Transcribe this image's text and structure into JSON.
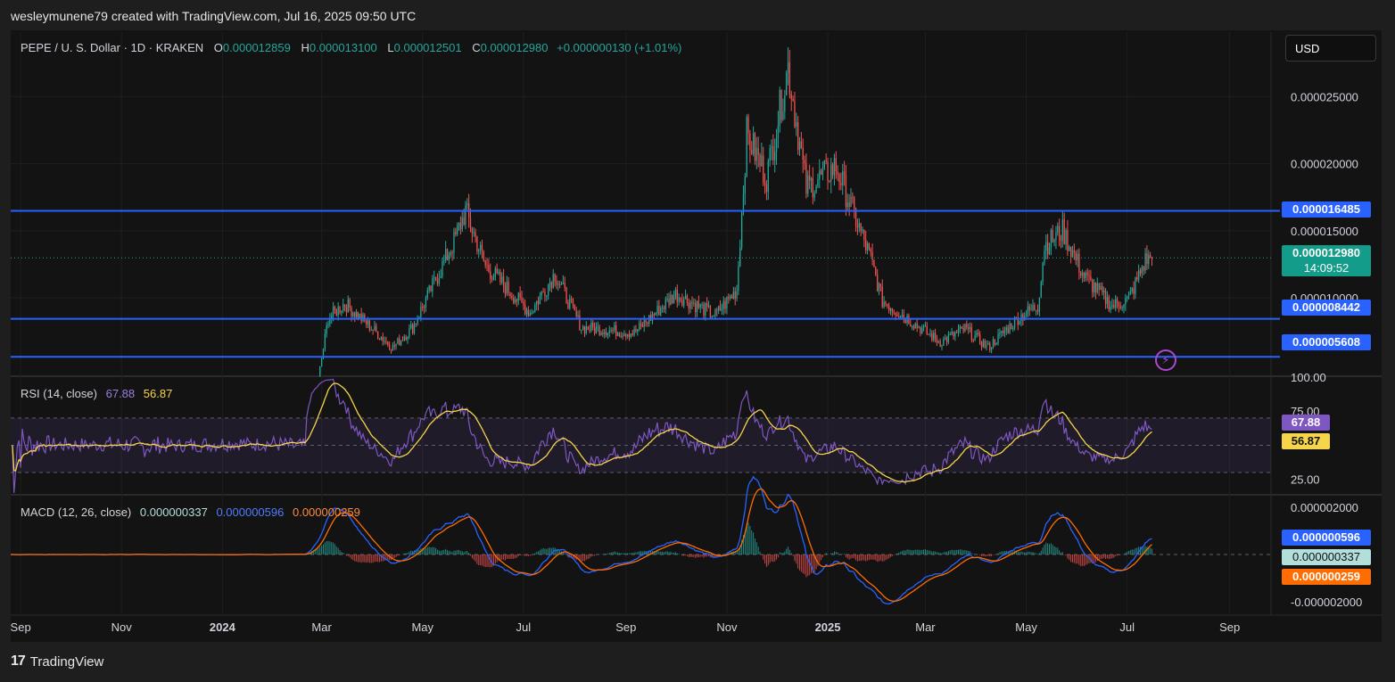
{
  "credit": "wesleymunene79 created with TradingView.com, Jul 16, 2025 09:50 UTC",
  "footer": {
    "brand": "TradingView",
    "logo": "17"
  },
  "currency_button": "USD",
  "price_legend": {
    "symbol": "PEPE / U. S. Dollar · 1D · KRAKEN",
    "o_label": "O",
    "o": "0.000012859",
    "h_label": "H",
    "h": "0.000013100",
    "l_label": "L",
    "l": "0.000012501",
    "c_label": "C",
    "c": "0.000012980",
    "change": "+0.000000130 (+1.01%)"
  },
  "rsi_legend": {
    "label": "RSI (14, close)",
    "rsi": "67.88",
    "ma": "56.87"
  },
  "macd_legend": {
    "label": "MACD (12, 26, close)",
    "hist": "0.000000337",
    "macd": "0.000000596",
    "signal": "0.000000259"
  },
  "badges": {
    "level_top": "0.000016485",
    "current_price": "0.000012980",
    "countdown": "14:09:52",
    "level_mid": "0.000008442",
    "level_low": "0.000005608",
    "rsi": "67.88",
    "rsi_ma": "56.87",
    "macd": "0.000000596",
    "hist": "0.000000337",
    "signal": "0.000000259"
  },
  "colors": {
    "up": "#26a69a",
    "down": "#ef5350",
    "level_line": "#2962ff",
    "rsi_line": "#7e57c2",
    "rsi_ma": "#f7d54a",
    "macd_line": "#2962ff",
    "signal_line": "#ff6d00"
  },
  "chart_data": [
    {
      "type": "candlestick",
      "title": "PEPE / U. S. Dollar · 1D · KRAKEN",
      "x_ticks": [
        "Sep",
        "Nov",
        "2024",
        "Mar",
        "May",
        "Jul",
        "Sep",
        "Nov",
        "2025",
        "Mar",
        "May",
        "Jul",
        "Sep"
      ],
      "y_ticks": [
        "0.000025000",
        "0.000020000",
        "0.000015000",
        "0.000010000"
      ],
      "ylim": [
        4.3e-06,
        2.98e-05
      ],
      "horizontal_levels": [
        1.6485e-05,
        8.442e-06,
        5.608e-06
      ],
      "last_price": 1.298e-05,
      "series_anchors": [
        [
          "2023-08-26",
          1.2e-06
        ],
        [
          "2024-02-20",
          1.2e-06
        ],
        [
          "2024-02-28",
          4e-06
        ],
        [
          "2024-03-05",
          8.5e-06
        ],
        [
          "2024-03-15",
          9.6e-06
        ],
        [
          "2024-04-13",
          6.3e-06
        ],
        [
          "2024-04-25",
          7.8e-06
        ],
        [
          "2024-05-20",
          1.42e-05
        ],
        [
          "2024-05-27",
          1.65e-05
        ],
        [
          "2024-06-08",
          1.24e-05
        ],
        [
          "2024-07-05",
          8.9e-06
        ],
        [
          "2024-07-20",
          1.18e-05
        ],
        [
          "2024-08-05",
          7.8e-06
        ],
        [
          "2024-09-06",
          7.4e-06
        ],
        [
          "2024-10-01",
          1.03e-05
        ],
        [
          "2024-10-25",
          8.7e-06
        ],
        [
          "2024-11-07",
          1.06e-05
        ],
        [
          "2024-11-13",
          2.22e-05
        ],
        [
          "2024-11-25",
          1.9e-05
        ],
        [
          "2024-12-08",
          2.72e-05
        ],
        [
          "2024-12-19",
          1.82e-05
        ],
        [
          "2025-01-06",
          1.98e-05
        ],
        [
          "2025-01-27",
          1.29e-05
        ],
        [
          "2025-02-03",
          9.8e-06
        ],
        [
          "2025-03-10",
          6.7e-06
        ],
        [
          "2025-03-25",
          7.7e-06
        ],
        [
          "2025-04-08",
          6.3e-06
        ],
        [
          "2025-04-26",
          8.5e-06
        ],
        [
          "2025-05-08",
          9.4e-06
        ],
        [
          "2025-05-12",
          1.39e-05
        ],
        [
          "2025-05-23",
          1.5e-05
        ],
        [
          "2025-06-05",
          1.16e-05
        ],
        [
          "2025-06-22",
          9.4e-06
        ],
        [
          "2025-07-02",
          9.9e-06
        ],
        [
          "2025-07-12",
          1.28e-05
        ],
        [
          "2025-07-16",
          1.298e-05
        ]
      ]
    },
    {
      "type": "line",
      "title": "RSI (14, close)",
      "y_ticks": [
        "100.00",
        "75.00",
        "25.00"
      ],
      "ylim": [
        15,
        100
      ],
      "bands": [
        30,
        50,
        70
      ],
      "series": [
        {
          "name": "RSI",
          "last": 67.88
        },
        {
          "name": "RSI MA",
          "last": 56.87
        }
      ]
    },
    {
      "type": "line",
      "title": "MACD (12, 26, close)",
      "y_ticks": [
        "0.000002000",
        "-0.000002000"
      ],
      "ylim": [
        -2.5e-06,
        2.5e-06
      ],
      "series": [
        {
          "name": "MACD",
          "last": 5.96e-07
        },
        {
          "name": "Signal",
          "last": 2.59e-07
        },
        {
          "name": "Histogram",
          "last": 3.37e-07
        }
      ]
    }
  ]
}
